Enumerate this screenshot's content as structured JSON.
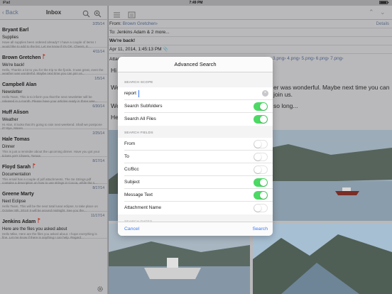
{
  "status_bar": {
    "carrier": "iPad",
    "time": "7:49 PM",
    "battery": ""
  },
  "inbox": {
    "back_label": "Back",
    "title": "Inbox",
    "messages": [
      {
        "sender": "Bryant Earl",
        "date": "2/25/14",
        "subject": "Supplies",
        "preview": "Have all supplies been ordered already? I have a couple of items I would like to add to the list. Let me know if it's OK. Cheers, E...",
        "flagged": false
      },
      {
        "sender": "Brown Gretchen",
        "date": "4/11/14",
        "subject": "We're back!",
        "preview": "Hello, Thanks a lot to you for the trip to the fjords. It was great, even the weather was wonderful. Maybe next time you can join us...",
        "flagged": true
      },
      {
        "sender": "Campbell Alan",
        "date": "1/5/14",
        "subject": "Newsletter",
        "preview": "Hello Team, This is to inform you that the next newsletter will be released in a month. Please have your articles ready in three wee...",
        "flagged": false
      },
      {
        "sender": "Huff Alison",
        "date": "6/30/14",
        "subject": "Weather",
        "preview": "Hi Alan, It looks that it's going to rain next weekend. Shall we postpone it? Bye, Maren",
        "flagged": false
      },
      {
        "sender": "Hale Tomas",
        "date": "2/25/14",
        "subject": "Dinner",
        "preview": "This is just a reminder about the upcoming dinner. Have you got your tickets yet? Cheers, Tomas",
        "flagged": false
      },
      {
        "sender": "Floyd Sarah",
        "date": "8/17/14",
        "subject": "Documentation",
        "preview": "This email has a couple of pdf attachments. The Se Strings.pdf contains a description on how to use strings in Cocoa, while the s...",
        "flagged": true
      },
      {
        "sender": "Greene Marty",
        "date": "8/17/14",
        "subject": "Next Eclipse",
        "preview": "Hello Team, This will be the next total lunar eclipse, to take place on October 8th, 2014! It will be around midnight. See you the...",
        "flagged": false
      },
      {
        "sender": "Jenkins Adam",
        "date": "11/17/14",
        "subject": "Here are the files you asked about",
        "preview": "Hello Mike, Here are the files you asked about. I hope everything is fine. Let me know if there is anything I can help. Regard...",
        "flagged": true
      }
    ]
  },
  "detail": {
    "from_label": "From:",
    "from_value": "Brown Gretchen",
    "to_label": "To:",
    "to_value": "Jenkins Adam & 2 more...",
    "details_label": "Details",
    "subject": "We're back!",
    "date": "Apr 11, 2014, 1:45:13 PM",
    "attachments_label": "Attac",
    "attachments": [
      "3.png",
      "4.png",
      "5.png",
      "6.png",
      "7.png"
    ],
    "greeting": "Hi A",
    "body_line1_start": "We",
    "body_line1_end": "er was wonderful. Maybe next time you can join us.",
    "body_line2_start": "We",
    "body_line2_end": "so long...",
    "sign_start": "He"
  },
  "dialog": {
    "title": "Advanced Search",
    "scope_header": "SEARCH SCOPE",
    "search_value": "report",
    "scope_options": [
      {
        "label": "Search Subfolders",
        "on": true
      },
      {
        "label": "Search All Files",
        "on": true
      }
    ],
    "fields_header": "SEARCH FIELDS",
    "fields": [
      {
        "label": "From",
        "on": false
      },
      {
        "label": "To",
        "on": false
      },
      {
        "label": "Cc/Bcc",
        "on": false
      },
      {
        "label": "Subject",
        "on": true
      },
      {
        "label": "Message Text",
        "on": true
      },
      {
        "label": "Attachment Name",
        "on": false
      }
    ],
    "dates_header": "SEARCH DATES",
    "cancel_label": "Cancel",
    "search_label": "Search"
  },
  "colors": {
    "accent": "#3478f6",
    "toggle_on": "#4cd964",
    "flag": "#c0392b"
  }
}
